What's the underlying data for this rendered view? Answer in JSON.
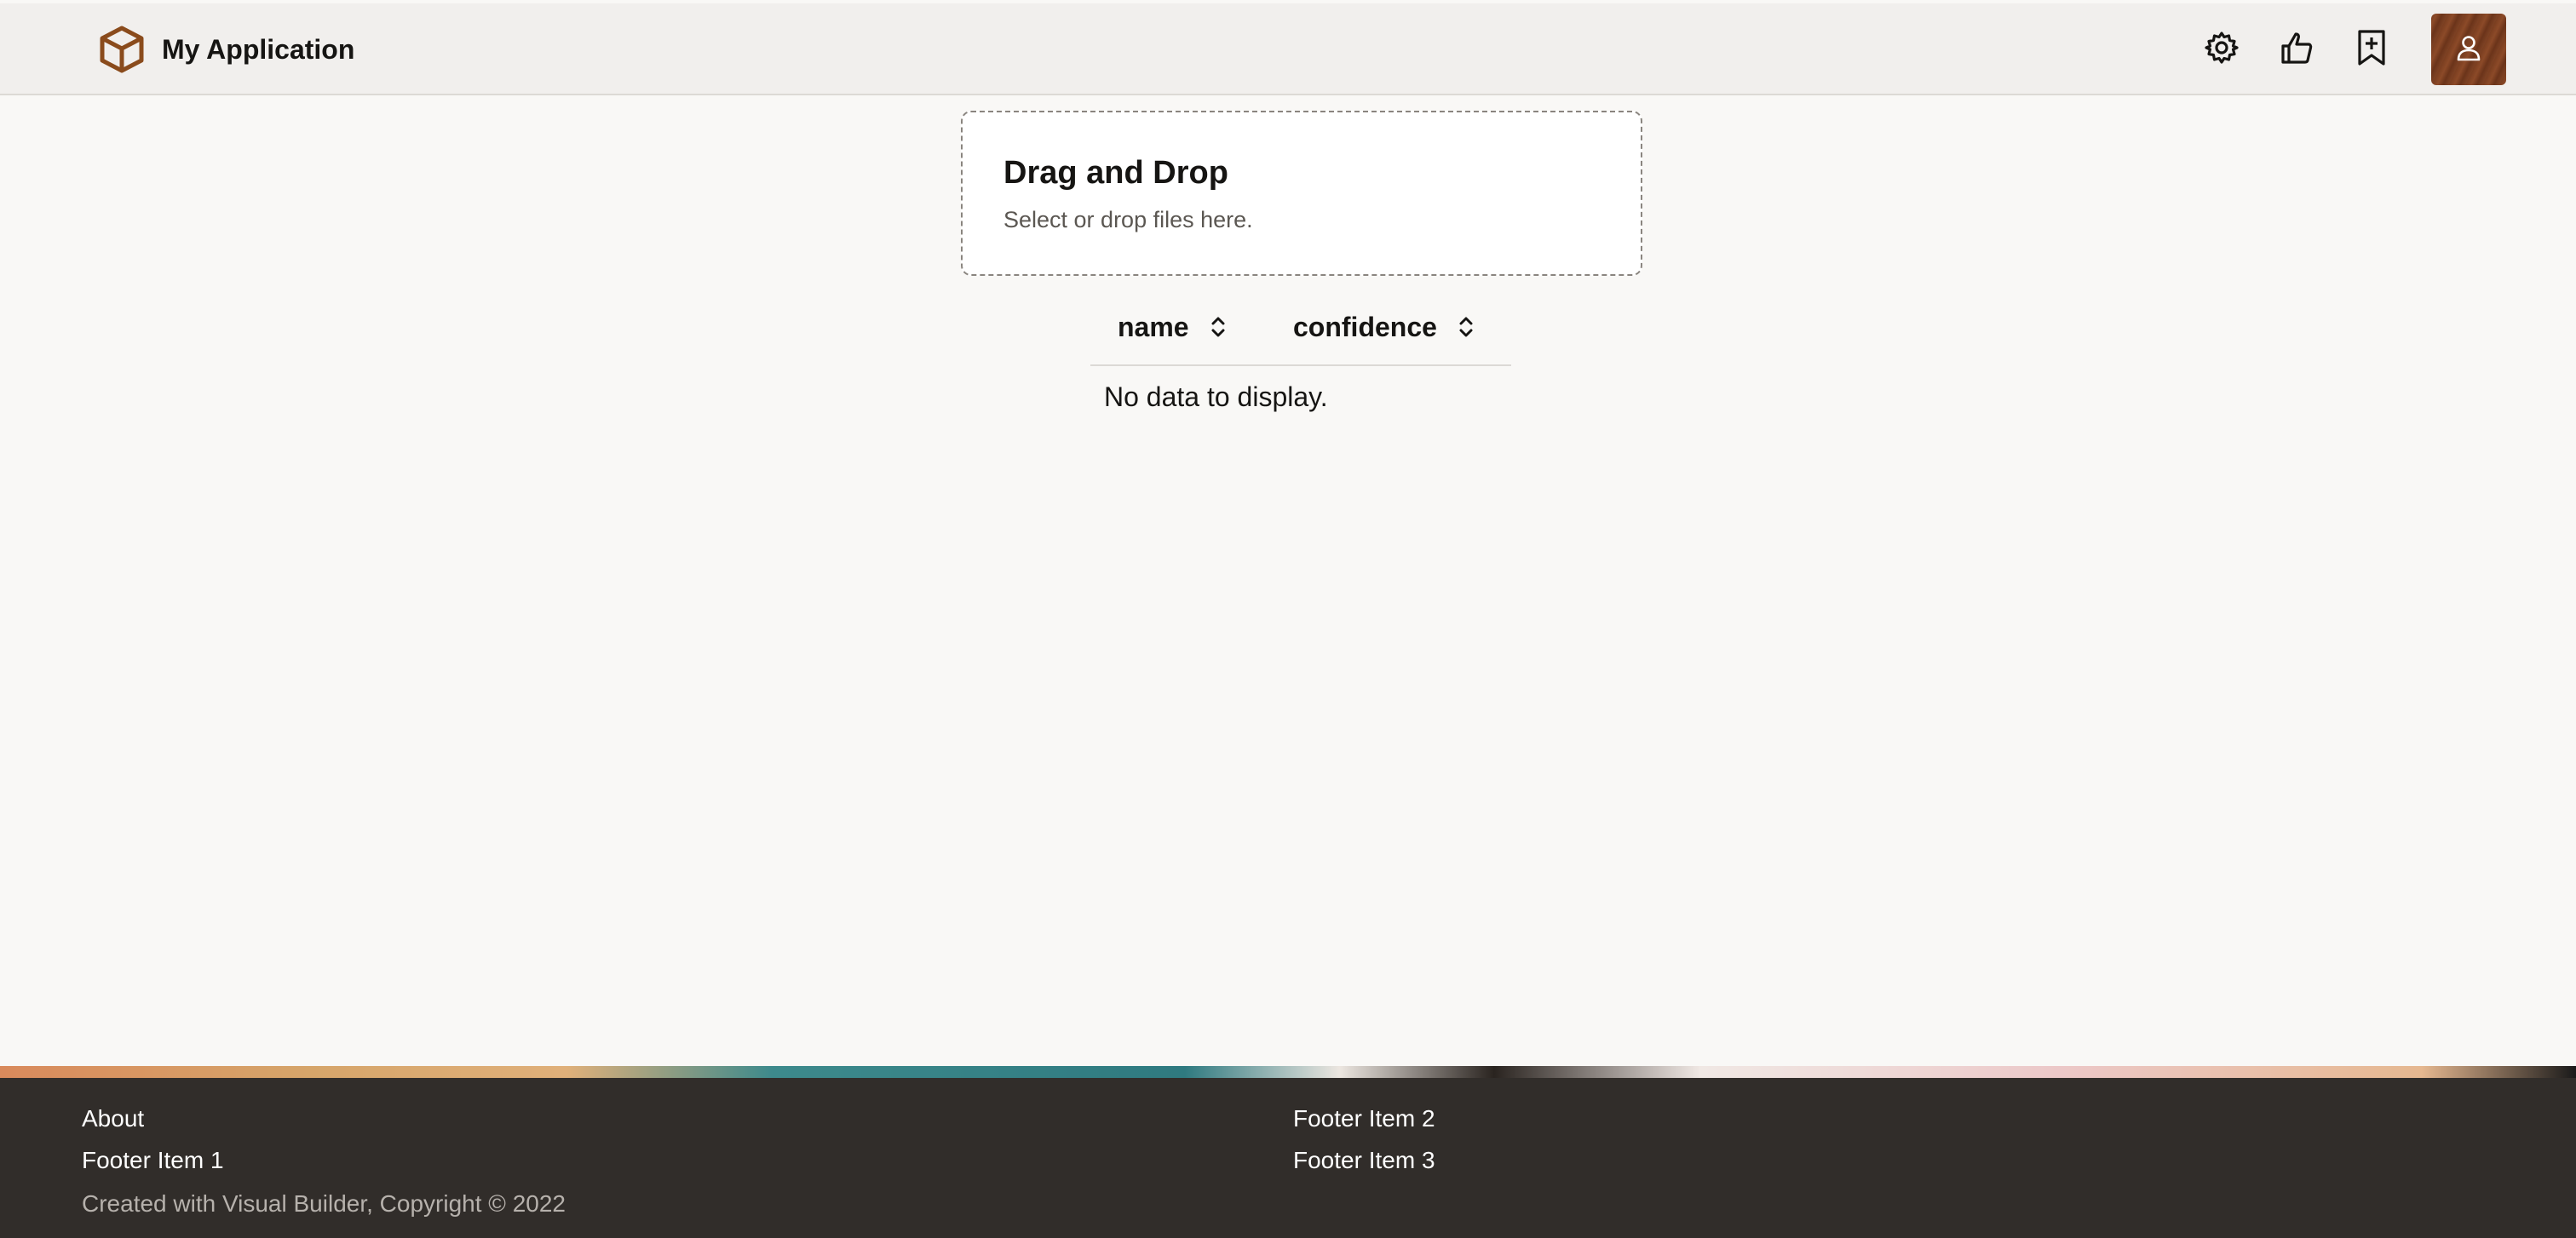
{
  "header": {
    "title": "My Application",
    "icons": [
      "cube-logo-icon",
      "gear-icon",
      "thumbs-up-icon",
      "bookmark-add-icon",
      "user-icon"
    ],
    "accent": "#8a4b1c"
  },
  "dropzone": {
    "title": "Drag and Drop",
    "subtitle": "Select or drop files here."
  },
  "table": {
    "columns": [
      {
        "label": "name"
      },
      {
        "label": "confidence"
      }
    ],
    "empty_text": "No data to display."
  },
  "footer": {
    "links": {
      "about": "About",
      "item1": "Footer Item 1",
      "item2": "Footer Item 2",
      "item3": "Footer Item 3"
    },
    "copyright": "Created with Visual Builder, Copyright © 2022"
  }
}
